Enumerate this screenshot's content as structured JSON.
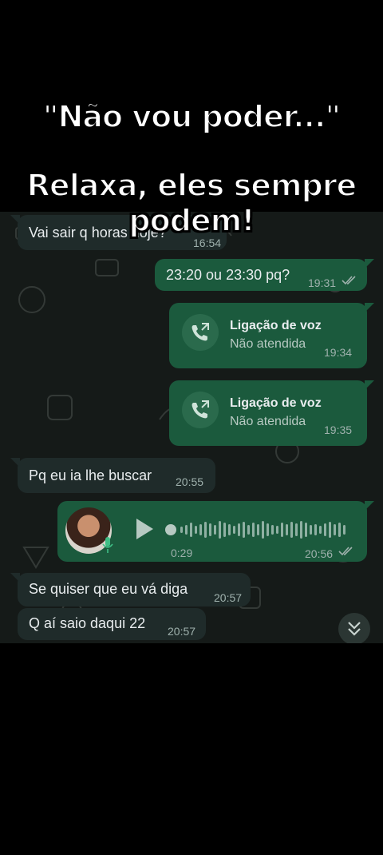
{
  "overlay": {
    "line1": "\"Não vou poder...\"",
    "line2": "Relaxa, eles sempre",
    "line3": "podem!"
  },
  "chat": {
    "messages": [
      {
        "direction": "in",
        "text": "Vai sair q horas hoje?",
        "time": "16:54"
      },
      {
        "direction": "out",
        "text": "23:20 ou 23:30 pq?",
        "time": "19:31",
        "read": true
      },
      {
        "direction": "out",
        "type": "call",
        "title": "Ligação de voz",
        "status": "Não atendida",
        "time": "19:34"
      },
      {
        "direction": "out",
        "type": "call",
        "title": "Ligação de voz",
        "status": "Não atendida",
        "time": "19:35"
      },
      {
        "direction": "in",
        "text": "Pq eu ia lhe buscar",
        "time": "20:55"
      },
      {
        "direction": "out",
        "type": "voice",
        "duration": "0:29",
        "time": "20:56",
        "read": true
      },
      {
        "direction": "in",
        "text": "Se quiser que eu vá diga",
        "time": "20:57"
      },
      {
        "direction": "in",
        "text": "Q aí saio daqui 22",
        "time": "20:57"
      }
    ],
    "icons": {
      "call": "outgoing-call-icon",
      "play": "play-icon",
      "mic": "microphone-icon",
      "ticks": "double-check-icon",
      "scroll": "double-chevron-down-icon"
    },
    "colors": {
      "incoming_bubble": "#1f2b2a",
      "outgoing_bubble": "#1b5a3d",
      "background": "#151a18"
    }
  }
}
